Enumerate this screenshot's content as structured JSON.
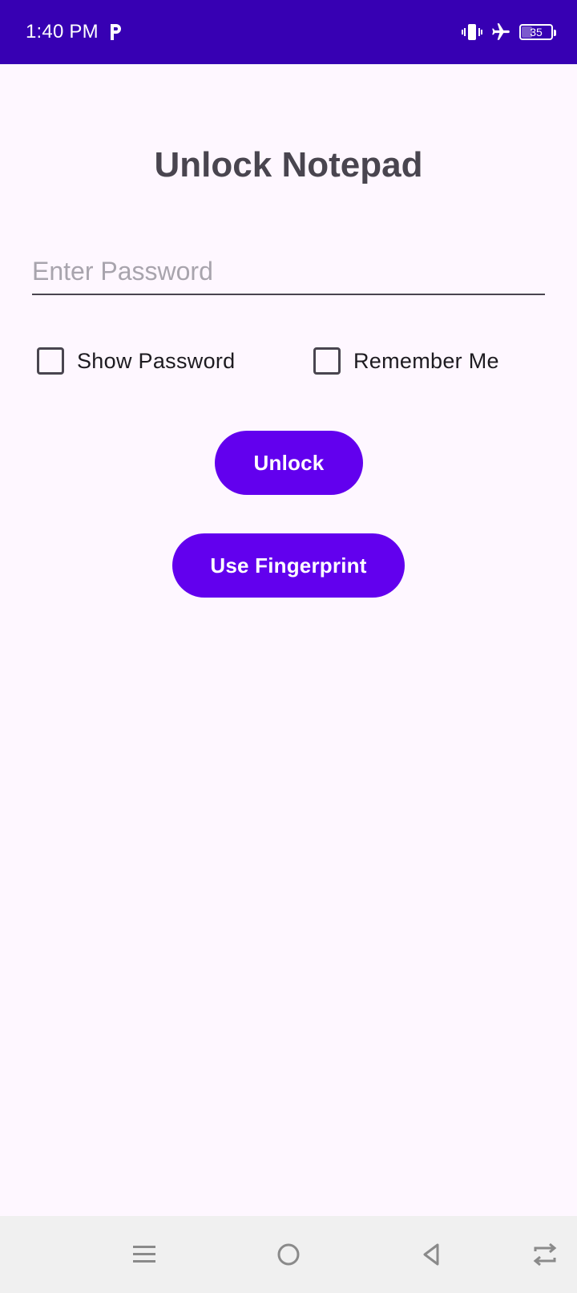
{
  "status_bar": {
    "time": "1:40 PM",
    "battery_level": "35",
    "icons": [
      "parking-icon",
      "vibrate-icon",
      "airplane-mode-icon",
      "battery-icon"
    ],
    "background": "#3700b3"
  },
  "screen": {
    "title": "Unlock Notepad",
    "password_field": {
      "value": "",
      "placeholder": "Enter Password"
    },
    "options": {
      "show_password": {
        "label": "Show Password",
        "checked": false
      },
      "remember_me": {
        "label": "Remember Me",
        "checked": false
      }
    },
    "buttons": {
      "unlock_label": "Unlock",
      "fingerprint_label": "Use Fingerprint"
    },
    "accent_color": "#6200ee"
  },
  "nav_bar": {
    "icons": [
      "menu-icon",
      "home-icon",
      "back-icon",
      "rotate-icon"
    ]
  }
}
